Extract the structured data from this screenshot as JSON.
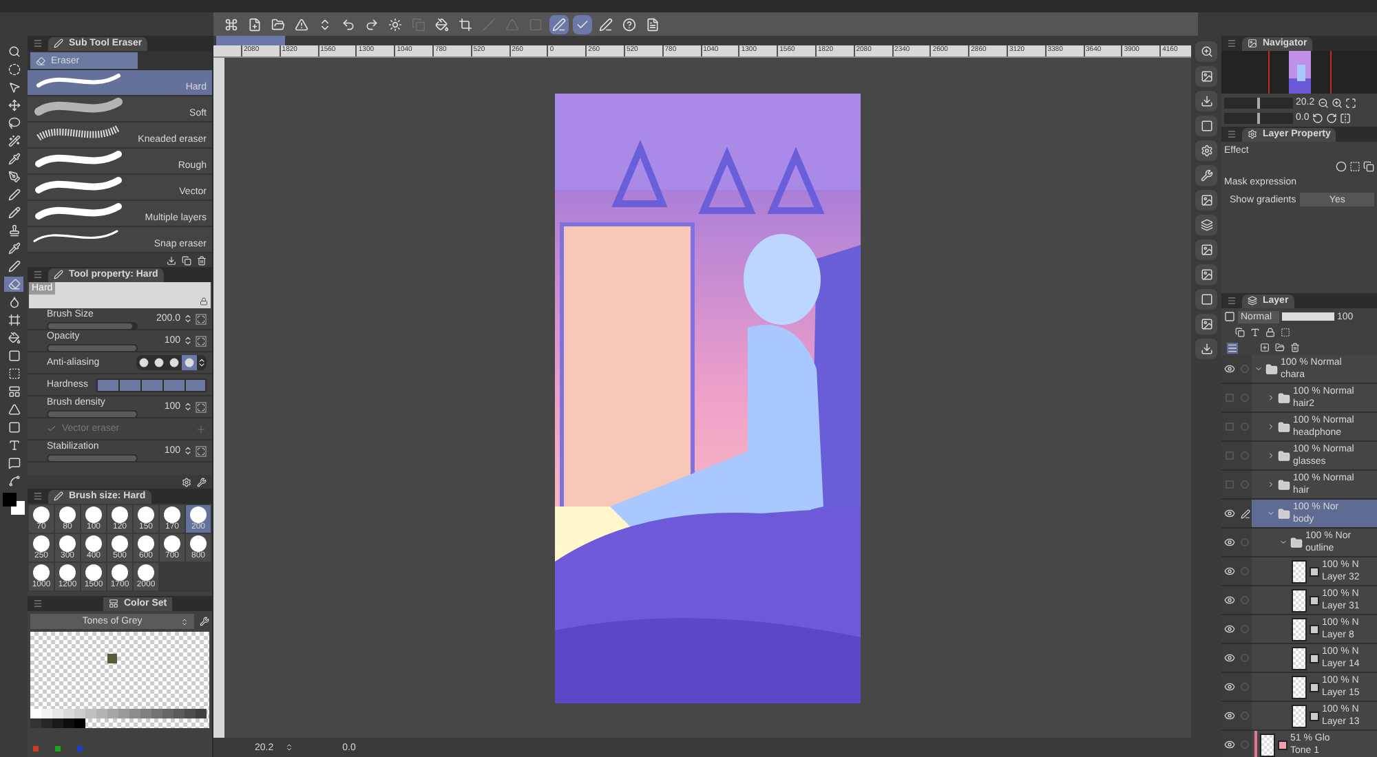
{
  "toolbar": [
    {
      "selected": false,
      "disabled": false
    },
    {
      "selected": false,
      "disabled": false
    },
    {
      "selected": false,
      "disabled": false
    },
    {
      "selected": false,
      "disabled": false
    },
    {
      "selected": false,
      "disabled": false
    },
    {
      "selected": false,
      "disabled": false
    },
    {
      "selected": false,
      "disabled": false
    },
    {
      "selected": false,
      "disabled": false
    },
    {
      "selected": false,
      "disabled": true
    },
    {
      "selected": false,
      "disabled": false
    },
    {
      "selected": false,
      "disabled": false
    },
    {
      "selected": false,
      "disabled": true
    },
    {
      "selected": false,
      "disabled": true
    },
    {
      "selected": false,
      "disabled": true
    },
    {
      "selected": true,
      "disabled": false
    },
    {
      "selected": true,
      "disabled": false
    },
    {
      "selected": false,
      "disabled": false
    },
    {
      "selected": false,
      "disabled": false
    },
    {
      "selected": false,
      "disabled": false
    }
  ],
  "tools": [
    {
      "selected": false
    },
    {
      "selected": false
    },
    {
      "selected": false
    },
    {
      "selected": false
    },
    {
      "selected": false
    },
    {
      "selected": false
    },
    {
      "selected": false
    },
    {
      "selected": false
    },
    {
      "selected": false
    },
    {
      "selected": false
    },
    {
      "selected": false
    },
    {
      "selected": false
    },
    {
      "selected": false
    },
    {
      "selected": true
    },
    {
      "selected": false
    },
    {
      "selected": false
    },
    {
      "selected": false
    },
    {
      "selected": false
    },
    {
      "selected": false
    },
    {
      "selected": false
    },
    {
      "selected": false
    },
    {
      "selected": false
    },
    {
      "selected": false
    },
    {
      "selected": false
    },
    {
      "selected": false
    }
  ],
  "colors": [
    {
      "color": "#000000"
    },
    {
      "color": "#ffffff"
    }
  ],
  "sub_tool": {
    "title": "Sub Tool Eraser",
    "group": "Eraser",
    "items": [
      {
        "label": "Hard",
        "kind": "hard",
        "selected": true
      },
      {
        "label": "Soft",
        "kind": "soft",
        "selected": false
      },
      {
        "label": "Kneaded eraser",
        "kind": "grainy",
        "selected": false
      },
      {
        "label": "Rough",
        "kind": "bold",
        "selected": false
      },
      {
        "label": "Vector",
        "kind": "bold",
        "selected": false
      },
      {
        "label": "Multiple layers",
        "kind": "bold",
        "selected": false
      },
      {
        "label": "Snap eraser",
        "kind": "thin",
        "selected": false
      }
    ]
  },
  "tool_property": {
    "title": "Tool property: Hard",
    "preview_label": "Hard",
    "rows": [
      {
        "kind": "slider",
        "label": "Brush Size",
        "value": "200.0",
        "level": 0.95
      },
      {
        "kind": "slider",
        "label": "Opacity",
        "value": "100",
        "level": 1
      },
      {
        "kind": "options",
        "label": "Anti-aliasing",
        "options": [
          {
            "selected": false
          },
          {
            "selected": false
          },
          {
            "selected": false
          },
          {
            "selected": true
          }
        ]
      },
      {
        "kind": "segments",
        "label": "Hardness",
        "level": 1
      },
      {
        "kind": "slider",
        "label": "Brush density",
        "value": "100",
        "level": 1
      },
      {
        "kind": "check",
        "label": "Vector eraser",
        "checked": true,
        "disabled": true
      },
      {
        "kind": "slider",
        "label": "Stabilization",
        "value": "100",
        "level": 1
      }
    ]
  },
  "brush_size": {
    "title": "Brush size: Hard",
    "sizes": [
      {
        "label": "70",
        "selected": false
      },
      {
        "label": "80",
        "selected": false
      },
      {
        "label": "100",
        "selected": false
      },
      {
        "label": "120",
        "selected": false
      },
      {
        "label": "150",
        "selected": false
      },
      {
        "label": "170",
        "selected": false
      },
      {
        "label": "200",
        "selected": true
      },
      {
        "label": "250",
        "selected": false
      },
      {
        "label": "300",
        "selected": false
      },
      {
        "label": "400",
        "selected": false
      },
      {
        "label": "500",
        "selected": false
      },
      {
        "label": "600",
        "selected": false
      },
      {
        "label": "700",
        "selected": false
      },
      {
        "label": "800",
        "selected": false
      },
      {
        "label": "1000",
        "selected": false
      },
      {
        "label": "1200",
        "selected": false
      },
      {
        "label": "1500",
        "selected": false
      },
      {
        "label": "1700",
        "selected": false
      },
      {
        "label": "2000",
        "selected": false
      }
    ]
  },
  "color_set": {
    "title": "Color Set",
    "palette": "Tones of Grey",
    "loose_swatch": {
      "color": "#5c5a3c"
    },
    "swatches": [
      {
        "color": "#ffffff"
      },
      {
        "color": "#f2f2f2"
      },
      {
        "color": "#e6e6e6"
      },
      {
        "color": "#d9d9d9"
      },
      {
        "color": "#cccccc"
      },
      {
        "color": "#bfbfbf"
      },
      {
        "color": "#b3b3b3"
      },
      {
        "color": "#a6a6a6"
      },
      {
        "color": "#999999"
      },
      {
        "color": "#8c8c8c"
      },
      {
        "color": "#808080"
      },
      {
        "color": "#737373"
      },
      {
        "color": "#666666"
      },
      {
        "color": "#595959"
      },
      {
        "color": "#4d4d4d"
      },
      {
        "color": "#404040"
      },
      {
        "color": "#333333"
      },
      {
        "color": "#262626"
      },
      {
        "color": "#1a1a1a"
      },
      {
        "color": "#0d0d0d"
      },
      {
        "color": "#000000"
      }
    ],
    "channels": [
      {
        "color": "#d23c1e"
      },
      {
        "color": "#1ea51e"
      },
      {
        "color": "#1e3cd2"
      }
    ]
  },
  "ruler": {
    "labels": [
      "2080",
      "1820",
      "1560",
      "1300",
      "1040",
      "780",
      "520",
      "260",
      "0",
      "260",
      "520",
      "780",
      "1040",
      "1300",
      "1560",
      "1820",
      "2080",
      "2340",
      "2600",
      "2860",
      "3120",
      "3380",
      "3640",
      "3900",
      "4160"
    ]
  },
  "status": {
    "zoom": "20.2",
    "angle": "0.0"
  },
  "navigator": {
    "title": "Navigator",
    "zoom": {
      "value": "20.2",
      "level": 0.5
    },
    "rotation": {
      "value": "0.0",
      "level": 0.5
    }
  },
  "layer_property": {
    "title": "Layer Property",
    "effect_label": "Effect",
    "mask_label": "Mask expression",
    "gradient_label": "Show gradients",
    "gradient_value": "Yes"
  },
  "layers": {
    "title": "Layer",
    "blend": "Normal",
    "opacity": "100",
    "items": [
      {
        "kind": "folder",
        "mode": "100 % Normal",
        "name": "chara",
        "visible": true,
        "editing": false,
        "selected": false,
        "expanded": true,
        "children": [
          {
            "kind": "folder",
            "mode": "100 % Normal",
            "name": "hair2",
            "visible": false,
            "editing": false,
            "selected": false,
            "expanded": false
          },
          {
            "kind": "folder",
            "mode": "100 % Normal",
            "name": "headphone",
            "visible": false,
            "editing": false,
            "selected": false,
            "expanded": false
          },
          {
            "kind": "folder",
            "mode": "100 % Normal",
            "name": "glasses",
            "visible": false,
            "editing": false,
            "selected": false,
            "expanded": false
          },
          {
            "kind": "folder",
            "mode": "100 % Normal",
            "name": "hair",
            "visible": false,
            "editing": false,
            "selected": false,
            "expanded": false
          },
          {
            "kind": "folder",
            "mode": "100 % Nor",
            "name": "body",
            "visible": true,
            "editing": true,
            "selected": true,
            "expanded": true,
            "children": [
              {
                "kind": "folder",
                "mode": "100 % Nor",
                "name": "outline",
                "visible": true,
                "editing": false,
                "selected": false,
                "expanded": true,
                "children": [
                  {
                    "kind": "raster",
                    "mode": "100 % N",
                    "name": "Layer 32",
                    "visible": true,
                    "editing": false,
                    "selected": false
                  },
                  {
                    "kind": "raster",
                    "mode": "100 % N",
                    "name": "Layer 31",
                    "visible": true,
                    "editing": false,
                    "selected": false
                  },
                  {
                    "kind": "raster",
                    "mode": "100 % N",
                    "name": "Layer 8",
                    "visible": true,
                    "editing": false,
                    "selected": false
                  },
                  {
                    "kind": "raster",
                    "mode": "100 % N",
                    "name": "Layer 14",
                    "visible": true,
                    "editing": false,
                    "selected": false
                  },
                  {
                    "kind": "raster",
                    "mode": "100 % N",
                    "name": "Layer 15",
                    "visible": true,
                    "editing": false,
                    "selected": false
                  },
                  {
                    "kind": "raster",
                    "mode": "100 % N",
                    "name": "Layer 13",
                    "visible": true,
                    "editing": false,
                    "selected": false
                  }
                ]
              }
            ]
          }
        ]
      },
      {
        "kind": "tone",
        "mode": "51 % Glo",
        "name": "Tone 1",
        "visible": true,
        "editing": false,
        "selected": false,
        "color": "#e07a8c"
      }
    ]
  }
}
